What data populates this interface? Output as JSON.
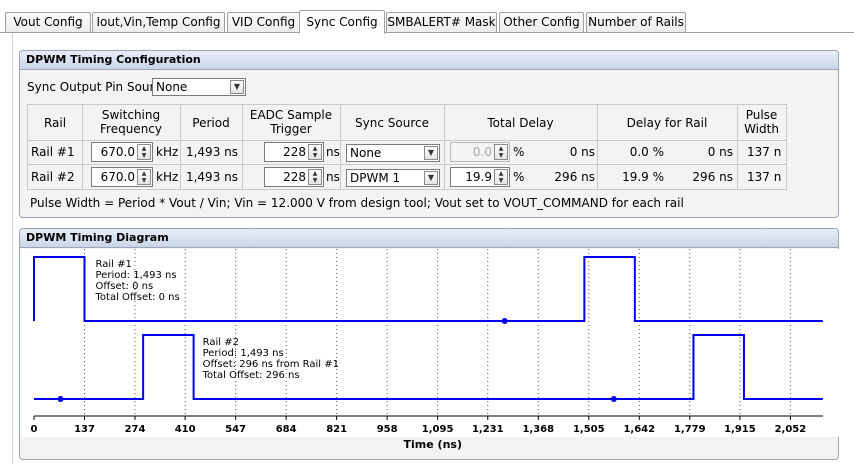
{
  "tabs": [
    {
      "label": "Vout Config",
      "active": false
    },
    {
      "label": "Iout,Vin,Temp Config",
      "active": false
    },
    {
      "label": "VID Config",
      "active": false
    },
    {
      "label": "Sync Config",
      "active": true
    },
    {
      "label": "SMBALERT# Mask",
      "active": false
    },
    {
      "label": "Other Config",
      "active": false
    },
    {
      "label": "Number of Rails",
      "active": false
    }
  ],
  "timing_config": {
    "title": "DPWM Timing Configuration",
    "sync_output_label": "Sync Output Pin Sourc",
    "sync_output_value": "None",
    "headers": {
      "rail": "Rail",
      "switching_freq_1": "Switching",
      "switching_freq_2": "Frequency",
      "period": "Period",
      "eadc_1": "EADC Sample",
      "eadc_2": "Trigger",
      "sync_source": "Sync Source",
      "total_delay": "Total Delay",
      "delay_for_rail": "Delay for Rail",
      "pulse_1": "Pulse",
      "pulse_2": "Width"
    },
    "rows": [
      {
        "rail": "Rail #1",
        "freq": "670.0",
        "freq_unit": "kHz",
        "period": "1,493 ns",
        "eadc": "228",
        "eadc_unit": "ns",
        "sync_source": "None",
        "total_delay_pct": "0.0",
        "total_delay_disabled": true,
        "pct": "%",
        "total_delay_ns": "0 ns",
        "delay_rail_pct": "0.0 %",
        "delay_rail_ns": "0 ns",
        "pulse_width": "137 n"
      },
      {
        "rail": "Rail #2",
        "freq": "670.0",
        "freq_unit": "kHz",
        "period": "1,493 ns",
        "eadc": "228",
        "eadc_unit": "ns",
        "sync_source": "DPWM 1",
        "total_delay_pct": "19.9",
        "total_delay_disabled": false,
        "pct": "%",
        "total_delay_ns": "296 ns",
        "delay_rail_pct": "19.9 %",
        "delay_rail_ns": "296 ns",
        "pulse_width": "137 n"
      }
    ],
    "footnote": "Pulse Width = Period * Vout / Vin; Vin = 12.000 V from design tool; Vout set to VOUT_COMMAND for each rail"
  },
  "timing_diagram": {
    "title": "DPWM Timing Diagram",
    "axis_label": "Time (ns)",
    "ticks": [
      "0",
      "137",
      "274",
      "410",
      "547",
      "684",
      "821",
      "958",
      "1,095",
      "1,231",
      "1,368",
      "1,505",
      "1,642",
      "1,779",
      "1,915",
      "2,052"
    ],
    "line_color": "#0000ee",
    "annotations": [
      {
        "lines": [
          "Rail #1",
          "Period: 1,493 ns",
          "Offset: 0 ns",
          "Total Offset: 0 ns"
        ]
      },
      {
        "lines": [
          "Rail #2",
          "Period: 1,493 ns",
          "Offset: 296 ns from Rail #1",
          "Total Offset: 296 ns"
        ]
      }
    ]
  },
  "chart_data": {
    "type": "line",
    "xlabel": "Time (ns)",
    "xlim": [
      0,
      2140
    ],
    "xticks": [
      0,
      137,
      274,
      410,
      547,
      684,
      821,
      958,
      1095,
      1231,
      1368,
      1505,
      1642,
      1779,
      1915,
      2052
    ],
    "series": [
      {
        "name": "Rail #1",
        "period_ns": 1493,
        "offset_ns": 0,
        "pulse_width_ns": 137,
        "edges": [
          [
            0,
            1
          ],
          [
            137,
            0
          ],
          [
            1493,
            1
          ],
          [
            1630,
            0
          ]
        ],
        "sample_marker_ns": 1277
      },
      {
        "name": "Rail #2",
        "period_ns": 1493,
        "offset_ns": 296,
        "pulse_width_ns": 137,
        "edges": [
          [
            0,
            0
          ],
          [
            296,
            1
          ],
          [
            433,
            0
          ],
          [
            1789,
            1
          ],
          [
            1926,
            0
          ]
        ],
        "sample_marker_ns": 1573,
        "early_marker_ns": 72
      }
    ]
  }
}
